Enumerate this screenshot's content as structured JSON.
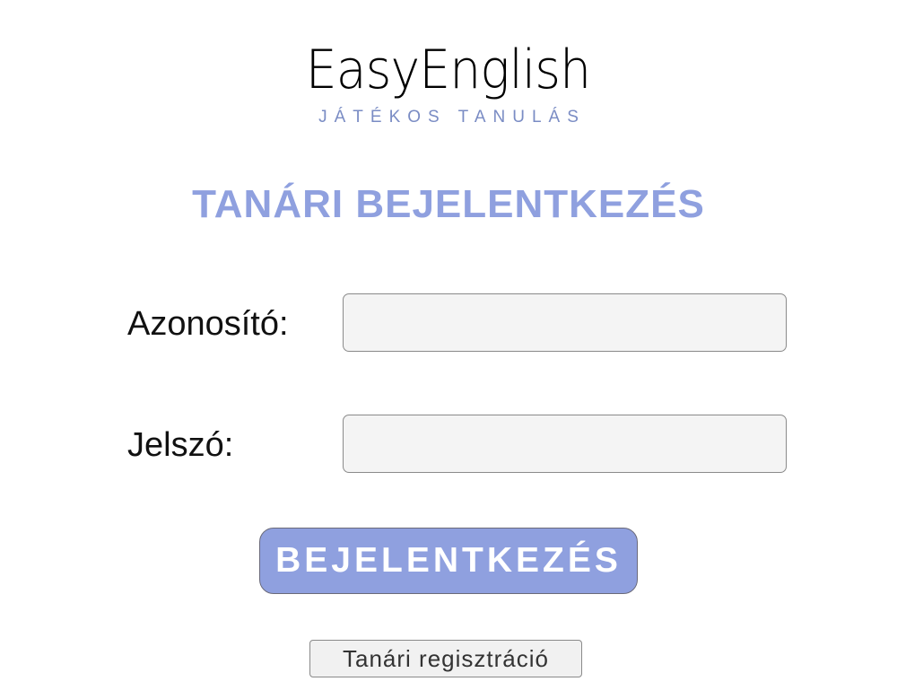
{
  "logo": {
    "title": "EasyEnglish",
    "tagline": "JÁTÉKOS TANULÁS"
  },
  "page_title": "TANÁRI BEJELENTKEZÉS",
  "form": {
    "id_label": "Azonosító:",
    "id_value": "",
    "password_label": "Jelszó:",
    "password_value": ""
  },
  "buttons": {
    "login_label": "BEJELENTKEZÉS",
    "register_label": "Tanári regisztráció"
  },
  "colors": {
    "accent": "#8fa0df",
    "tagline": "#7a8cc4",
    "input_bg": "#f4f4f4"
  }
}
